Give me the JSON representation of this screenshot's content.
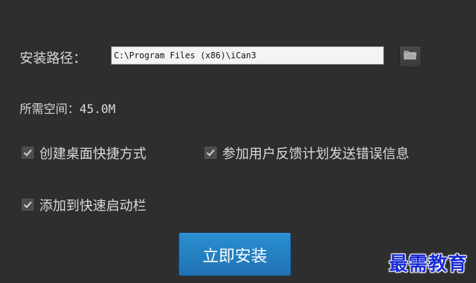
{
  "install_path": {
    "label": "安装路径：",
    "value": "C:\\Program Files (x86)\\iCan3",
    "browse_icon": "folder-icon"
  },
  "required_space": {
    "label": "所需空间：45.0M"
  },
  "options": {
    "desktop_shortcut": {
      "label": "创建桌面快捷方式",
      "checked": true
    },
    "feedback_program": {
      "label": "参加用户反馈计划发送错误信息",
      "checked": true
    },
    "quick_launch": {
      "label": "添加到快速启动栏",
      "checked": true
    }
  },
  "install_button": {
    "label": "立即安装"
  },
  "watermark": {
    "text": "最需教育"
  },
  "colors": {
    "background": "#2e2e2e",
    "accent": "#1f72b4",
    "watermark": "#1a2bd6"
  }
}
